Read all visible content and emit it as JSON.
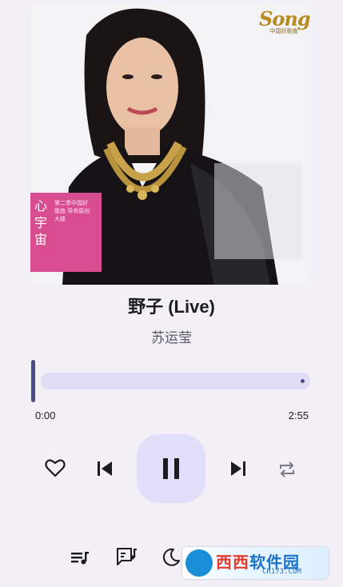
{
  "album_art": {
    "logo_line1": "Song",
    "logo_line2": "中国好歌曲",
    "tag_main": "心宇宙",
    "tag_sub": "第二季中国好歌曲 导师原创大碟"
  },
  "track": {
    "title": "野子 (Live)",
    "artist": "苏运莹"
  },
  "progress": {
    "current": "0:00",
    "total": "2:55",
    "fraction": 0.0
  },
  "controls": {
    "like": "heart-icon",
    "previous": "skip-previous-icon",
    "play_pause": "pause-icon",
    "next": "skip-next-icon",
    "repeat": "repeat-icon"
  },
  "bottom_bar": {
    "queue": "queue-music-icon",
    "lyrics": "lyrics-icon",
    "sleep_timer": "moon-icon"
  },
  "watermark": {
    "text_red": "西西",
    "text_blue": "软件园",
    "url": "CR173.COM"
  },
  "colors": {
    "background": "#f2eff6",
    "accent": "#4a4c86",
    "track": "#dfdcf6",
    "play_container": "#e0def8",
    "tag_pink": "#d84c90"
  }
}
